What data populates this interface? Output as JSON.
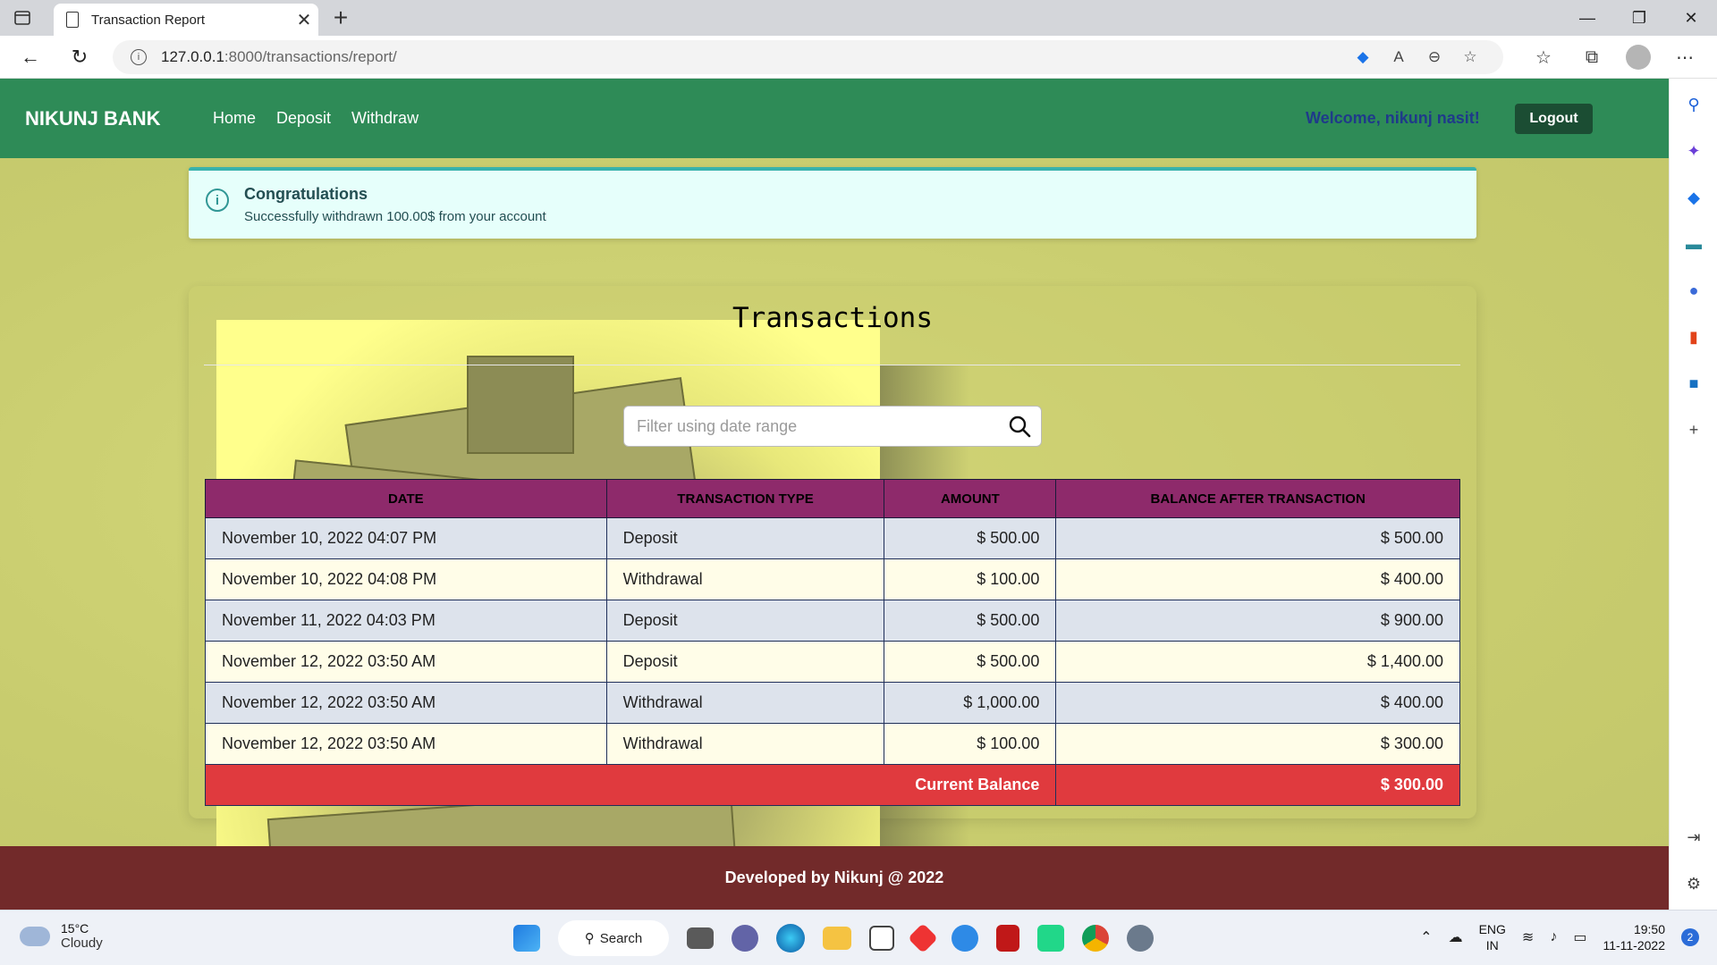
{
  "browser": {
    "tab_title": "Transaction Report",
    "url_host": "127.0.0.1",
    "url_path": ":8000/transactions/report/"
  },
  "nav": {
    "brand": "NIKUNJ BANK",
    "links": [
      "Home",
      "Deposit",
      "Withdraw"
    ],
    "welcome": "Welcome, nikunj nasit!",
    "logout": "Logout"
  },
  "alert": {
    "heading": "Congratulations",
    "message": "Successfully withdrawn 100.00$ from your account"
  },
  "report": {
    "title": "Transactions",
    "filter_placeholder": "Filter using date range",
    "headers": [
      "DATE",
      "TRANSACTION TYPE",
      "AMOUNT",
      "BALANCE AFTER TRANSACTION"
    ],
    "rows": [
      {
        "date": "November 10, 2022 04:07 PM",
        "type": "Deposit",
        "amount": "$ 500.00",
        "balance": "$ 500.00"
      },
      {
        "date": "November 10, 2022 04:08 PM",
        "type": "Withdrawal",
        "amount": "$ 100.00",
        "balance": "$ 400.00"
      },
      {
        "date": "November 11, 2022 04:03 PM",
        "type": "Deposit",
        "amount": "$ 500.00",
        "balance": "$ 900.00"
      },
      {
        "date": "November 12, 2022 03:50 AM",
        "type": "Deposit",
        "amount": "$ 500.00",
        "balance": "$ 1,400.00"
      },
      {
        "date": "November 12, 2022 03:50 AM",
        "type": "Withdrawal",
        "amount": "$ 1,000.00",
        "balance": "$ 400.00"
      },
      {
        "date": "November 12, 2022 03:50 AM",
        "type": "Withdrawal",
        "amount": "$ 100.00",
        "balance": "$ 300.00"
      }
    ],
    "current_balance_label": "Current Balance",
    "current_balance_value": "$ 300.00"
  },
  "footer": {
    "text": "Developed by Nikunj @ 2022"
  },
  "taskbar": {
    "temperature": "15°C",
    "weather": "Cloudy",
    "search_label": "Search",
    "lang_top": "ENG",
    "lang_bottom": "IN",
    "time": "19:50",
    "date": "11-11-2022",
    "notification_count": "2"
  },
  "colors": {
    "navbar": "#2e8b57",
    "header_row": "#8e2a6b",
    "balance_row": "#e03a3e",
    "footer": "#722a2a",
    "page_bg": "#c8cc6e"
  }
}
